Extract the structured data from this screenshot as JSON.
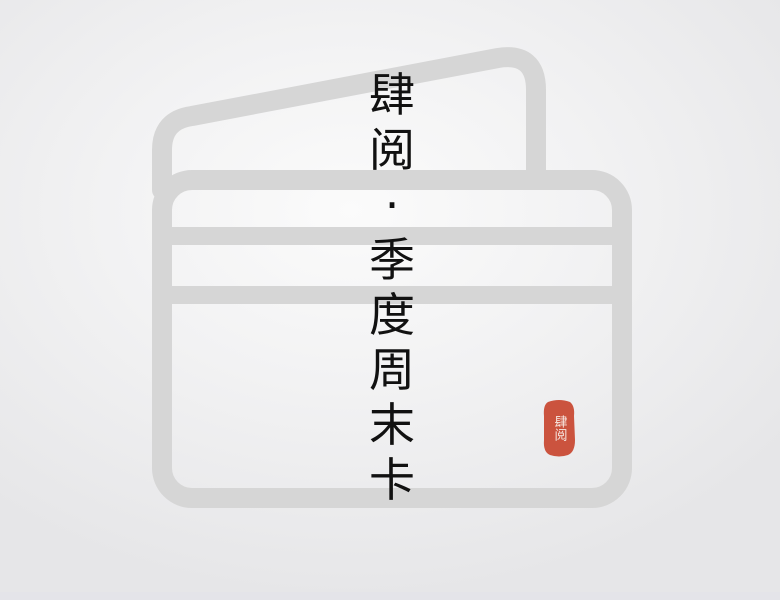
{
  "poster": {
    "title_chars": [
      "肆",
      "阅",
      "·",
      "季",
      "度",
      "周",
      "末",
      "卡"
    ],
    "seal_text": "肆阅"
  },
  "colors": {
    "card_outline": "#d6d6d6",
    "title": "#111111",
    "seal_red": "#c8452f",
    "background": "#f2f2f3"
  },
  "icons": {
    "card": "stacked-cards-icon",
    "seal": "red-seal-stamp"
  }
}
